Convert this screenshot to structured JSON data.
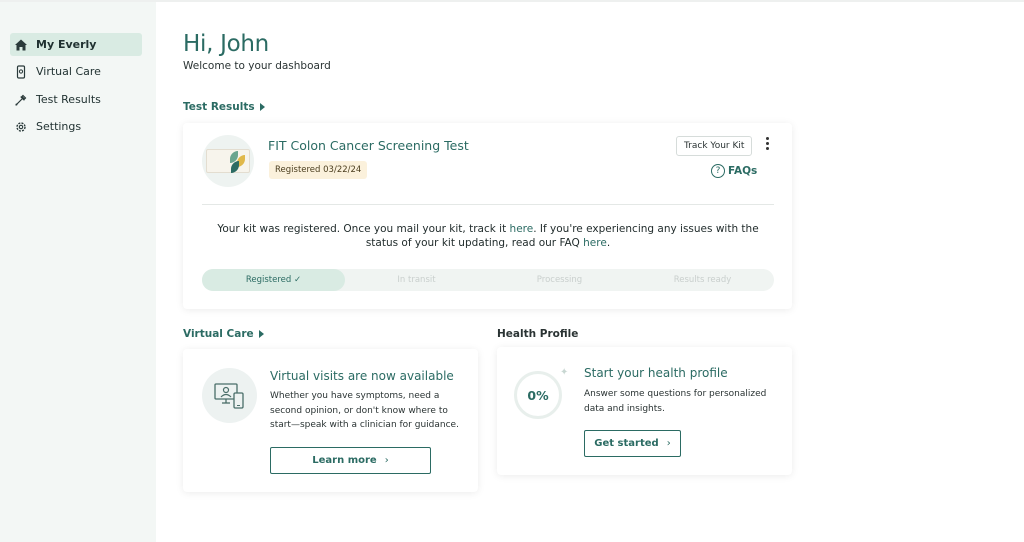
{
  "sidebar": {
    "items": [
      {
        "label": "My Everly",
        "icon": "home-icon",
        "active": true
      },
      {
        "label": "Virtual Care",
        "icon": "phone-icon",
        "active": false
      },
      {
        "label": "Test Results",
        "icon": "dropper-icon",
        "active": false
      },
      {
        "label": "Settings",
        "icon": "gear-icon",
        "active": false
      }
    ]
  },
  "header": {
    "greeting": "Hi, John",
    "subtitle": "Welcome to your dashboard"
  },
  "test_results": {
    "section_label": "Test Results",
    "test_name": "FIT Colon Cancer Screening Test",
    "registered_badge": "Registered 03/22/24",
    "track_button": "Track Your Kit",
    "faq_icon": "?",
    "faq_label": "FAQs",
    "message": {
      "part1": "Your kit was registered. Once you mail your kit, track it ",
      "link1": "here",
      "part2": ". If you're experiencing any issues with the status of your kit updating, read our FAQ ",
      "link2": "here",
      "part3": "."
    },
    "steps": [
      {
        "label": "Registered ✓",
        "done": true
      },
      {
        "label": "In transit",
        "done": false
      },
      {
        "label": "Processing",
        "done": false
      },
      {
        "label": "Results ready",
        "done": false
      }
    ]
  },
  "virtual_care": {
    "section_label": "Virtual Care",
    "title": "Virtual visits are now available",
    "text": "Whether you have symptoms, need a second opinion, or don't know where to start—speak with a clinician for guidance.",
    "button": "Learn more",
    "button_chevron": "›"
  },
  "health_profile": {
    "section_label": "Health Profile",
    "percent": "0%",
    "title": "Start your health profile",
    "text": "Answer some questions for personalized data and insights.",
    "button": "Get started",
    "button_chevron": "›"
  },
  "colors": {
    "accent": "#2b6b63",
    "sidebar_bg": "#f3f7f5",
    "active_bg": "#d9ebe3",
    "badge_bg": "#fbf1dc"
  }
}
